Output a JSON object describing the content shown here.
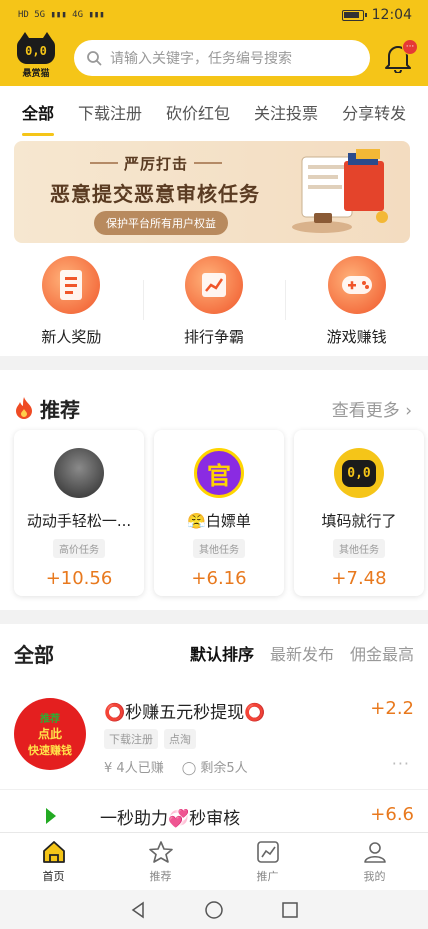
{
  "status_bar": {
    "time": "12:04",
    "left_indicators": "HD 5G ▮▮▮ 4G ▮▮▮"
  },
  "header": {
    "logo_face": "0,0",
    "logo_text": "悬赏猫",
    "search_placeholder": "请输入关键字，任务编号搜索",
    "bell_badge": "···"
  },
  "tabs": [
    {
      "label": "全部",
      "active": true
    },
    {
      "label": "下载注册"
    },
    {
      "label": "砍价红包"
    },
    {
      "label": "关注投票"
    },
    {
      "label": "分享转发"
    }
  ],
  "banner": {
    "line1": "严厉打击",
    "line2": "恶意提交恶意审核任务",
    "line3": "保护平台所有用户权益"
  },
  "quick_entries": [
    {
      "label": "新人奖励",
      "icon": "gift-doc-icon"
    },
    {
      "label": "排行争霸",
      "icon": "chart-icon"
    },
    {
      "label": "游戏赚钱",
      "icon": "gamepad-icon"
    }
  ],
  "recommend": {
    "title": "推荐",
    "more": "查看更多",
    "cards": [
      {
        "name": "动动手轻松一...",
        "tag": "高价任务",
        "price": "+10.56",
        "avatar_text": "",
        "avatar_color": "#3a3a3a"
      },
      {
        "name": "😤白嫖单",
        "tag": "其他任务",
        "price": "+6.16",
        "avatar_text": "官",
        "avatar_color": "#8a2be2"
      },
      {
        "name": "填码就行了",
        "tag": "其他任务",
        "price": "+7.48",
        "avatar_text": "0,0",
        "avatar_color": "#f5c518"
      }
    ]
  },
  "all": {
    "title": "全部",
    "sorts": [
      {
        "label": "默认排序",
        "active": true
      },
      {
        "label": "最新发布"
      },
      {
        "label": "佣金最高"
      }
    ],
    "items": [
      {
        "title": "⭕秒赚五元秒提现⭕",
        "tags": [
          "下载注册",
          "点淘"
        ],
        "earned": "4人已赚",
        "remaining": "剩余5人",
        "price": "+2.2",
        "thumb_lines": [
          "推荐",
          "点此",
          "快速赚钱"
        ]
      },
      {
        "title": "一秒助力💞秒审核",
        "price": "+6.6"
      }
    ]
  },
  "bottom_nav": [
    {
      "label": "首页",
      "icon": "home-icon",
      "active": true
    },
    {
      "label": "推荐",
      "icon": "star-icon"
    },
    {
      "label": "推广",
      "icon": "trend-icon"
    },
    {
      "label": "我的",
      "icon": "user-icon"
    }
  ],
  "colors": {
    "brand": "#f5c518",
    "price": "#e8791e"
  }
}
